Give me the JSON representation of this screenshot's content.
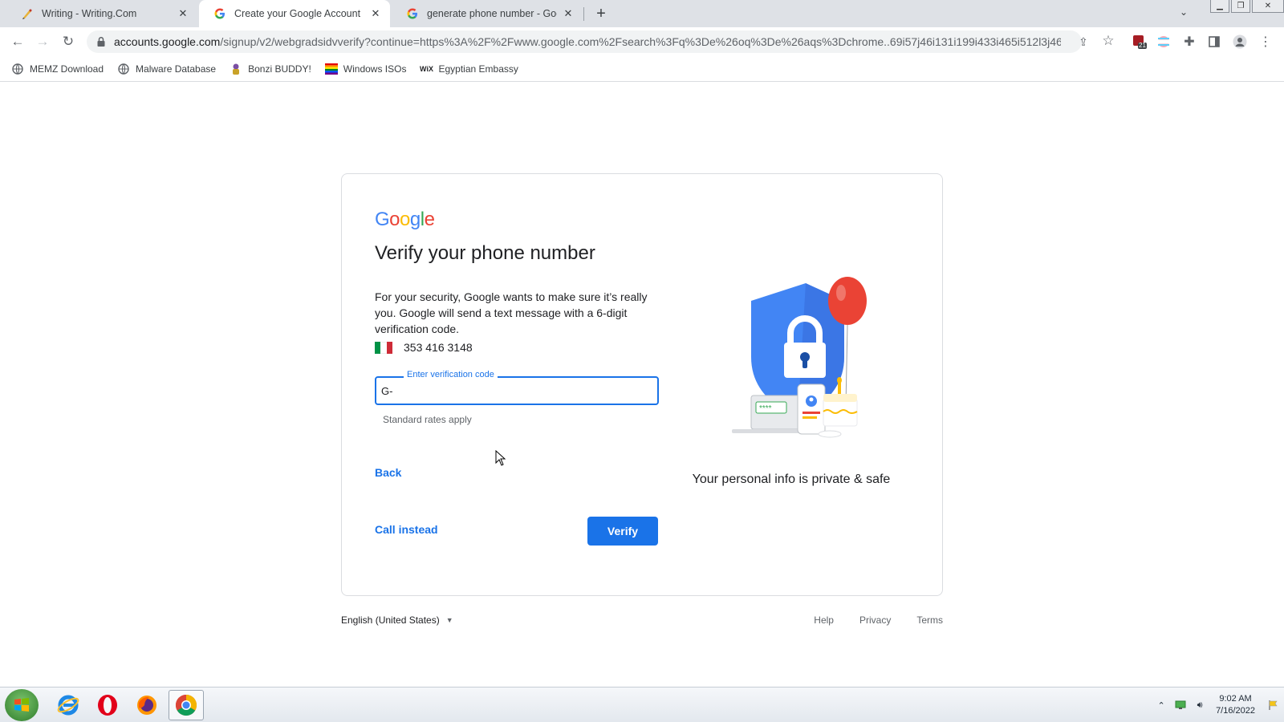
{
  "tabs": [
    {
      "title": "Writing - Writing.Com",
      "icon": "writing-com-icon"
    },
    {
      "title": "Create your Google Account",
      "icon": "google-icon"
    },
    {
      "title": "generate phone number - Googl",
      "icon": "google-icon"
    }
  ],
  "url": {
    "host": "accounts.google.com",
    "rest": "/signup/v2/webgradsidvverify?continue=https%3A%2F%2Fwww.google.com%2Fsearch%3Fq%3De%26oq%3De%26aqs%3Dchrome..69i57j46i131i199i433i465i512l3j46i1..."
  },
  "extension_badge": "21",
  "bookmarks": [
    {
      "label": "MEMZ Download",
      "icon": "globe-icon"
    },
    {
      "label": "Malware Database",
      "icon": "globe-icon"
    },
    {
      "label": "Bonzi BUDDY!",
      "icon": "bonzi-icon"
    },
    {
      "label": "Windows ISOs",
      "icon": "rainbow-icon"
    },
    {
      "label": "Egyptian Embassy",
      "icon": "wix-icon"
    }
  ],
  "bookmark_wix_text": "WiX",
  "card": {
    "logo": [
      "G",
      "o",
      "o",
      "g",
      "l",
      "e"
    ],
    "heading": "Verify your phone number",
    "description": "For your security, Google wants to make sure it’s really you. Google will send a text message with a 6-digit verification code.",
    "phone": "353 416 3148",
    "field_label": "Enter verification code",
    "field_value": "G-",
    "hint": "Standard rates apply",
    "back": "Back",
    "call_instead": "Call instead",
    "verify": "Verify",
    "illustration_caption": "Your personal info is private & safe",
    "illustration_password_mask": "****"
  },
  "footer": {
    "language": "English (United States)",
    "links": [
      "Help",
      "Privacy",
      "Terms"
    ]
  },
  "taskbar": {
    "apps": [
      "internet-explorer-icon",
      "opera-icon",
      "firefox-icon",
      "chrome-icon"
    ],
    "time": "9:02 AM",
    "date": "7/16/2022"
  },
  "colors": {
    "accent": "#1a73e8",
    "google_blue": "#4285f4",
    "google_red": "#ea4335",
    "google_yellow": "#fbbc05",
    "google_green": "#34a853",
    "flag_green": "#009246",
    "flag_white": "#ffffff",
    "flag_red": "#ce2b37"
  }
}
